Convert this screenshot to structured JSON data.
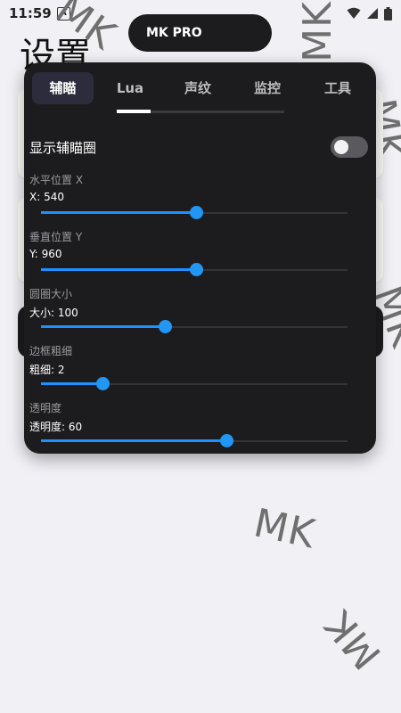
{
  "status_bar": {
    "time": "11:59",
    "notif_letter": "A"
  },
  "watermark": "MK",
  "page": {
    "title": "设置"
  },
  "pill": {
    "label": "MK PRO"
  },
  "tabs": [
    {
      "label": "辅瞄",
      "active": true
    },
    {
      "label": "Lua",
      "active": false
    },
    {
      "label": "声纹",
      "active": false
    },
    {
      "label": "监控",
      "active": false
    },
    {
      "label": "工具",
      "active": false
    }
  ],
  "toggle": {
    "label": "显示辅瞄圈",
    "on": false
  },
  "sliders": [
    {
      "title": "水平位置 X",
      "value_text": "X: 540",
      "fraction": 0.505
    },
    {
      "title": "垂直位置 Y",
      "value_text": "Y: 960",
      "fraction": 0.505
    },
    {
      "title": "圆圈大小",
      "value_text": "大小: 100",
      "fraction": 0.405
    },
    {
      "title": "边框粗细",
      "value_text": "粗细: 2",
      "fraction": 0.2
    },
    {
      "title": "透明度",
      "value_text": "透明度: 60",
      "fraction": 0.605
    }
  ],
  "colors": {
    "panel": "#1c1c1e",
    "accent": "#2196f3",
    "background": "#f1f0f5"
  }
}
